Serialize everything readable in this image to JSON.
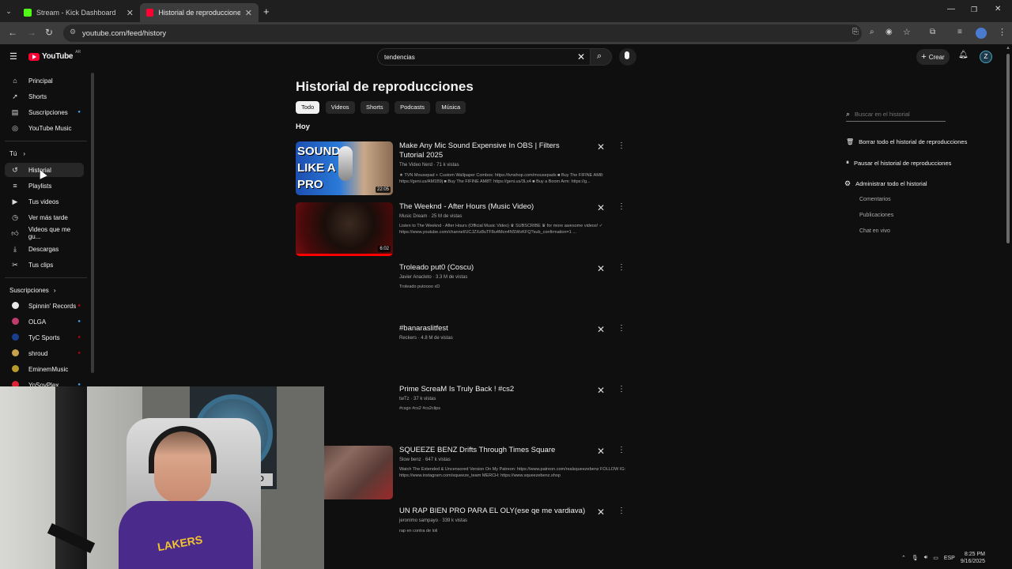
{
  "browser": {
    "tabs": [
      {
        "title": "Stream - Kick Dashboard",
        "favicon_color": "#53fc18"
      },
      {
        "title": "Historial de reproducciones - Y",
        "favicon_color": "#ff0033"
      }
    ],
    "url": "youtube.com/feed/history"
  },
  "header": {
    "logo": "YouTube",
    "region": "AR",
    "search_value": "tendencias",
    "create_label": "Crear",
    "avatar_letter": "Z"
  },
  "sidebar": {
    "main_items": [
      {
        "label": "Principal",
        "icon": "home-icon"
      },
      {
        "label": "Shorts",
        "icon": "shorts-icon"
      },
      {
        "label": "Suscripciones",
        "icon": "subscriptions-icon"
      },
      {
        "label": "YouTube Music",
        "icon": "music-icon"
      }
    ],
    "you_label": "Tú",
    "you_items": [
      {
        "label": "Historial",
        "icon": "history-icon"
      },
      {
        "label": "Playlists",
        "icon": "playlist-icon"
      },
      {
        "label": "Tus videos",
        "icon": "video-icon"
      },
      {
        "label": "Ver más tarde",
        "icon": "clock-icon"
      },
      {
        "label": "Videos que me gu...",
        "icon": "like-icon"
      },
      {
        "label": "Descargas",
        "icon": "download-icon"
      },
      {
        "label": "Tus clips",
        "icon": "scissors-icon"
      }
    ],
    "subscriptions_label": "Suscripciones",
    "subscriptions": [
      {
        "label": "Spinnin' Records",
        "color": "#e8e8e8"
      },
      {
        "label": "OLGA",
        "color": "#c03a6b"
      },
      {
        "label": "TyC Sports",
        "color": "#1a3f8f"
      },
      {
        "label": "shroud",
        "color": "#c7a24a"
      },
      {
        "label": "EminemMusic",
        "color": "#b89b2a"
      },
      {
        "label": "YoSoyPlex",
        "color": "#d23"
      }
    ]
  },
  "main": {
    "page_title": "Historial de reproducciones",
    "chips": [
      "Todo",
      "Videos",
      "Shorts",
      "Podcasts",
      "Música"
    ],
    "section_label": "Hoy",
    "videos": [
      {
        "title": "Make Any Mic Sound Expensive In OBS | Filters Tutorial 2025",
        "meta": "The Video Nerd · 71 k vistas",
        "desc": "★ TVN Mousepad + Custom Wallpaper Combos: https://tvnshop.com/mousepads ■ Buy The FIFINE AM8: https://geni.us/AM1B9j ■ Buy The FIFINE AM8T: https://geni.us/3Lx4 ■ Buy a Boom Arm: https://g...",
        "duration": "22:05",
        "thumb_text": "SOUND LIKE A PRO"
      },
      {
        "title": "The Weeknd - After Hours (Music Video)",
        "meta": "Music Dream · 25 M de vistas",
        "desc": "Listen to The Weeknd - After Hours (Official Music Video) ♛ SUBSCRIBE ♛ for more awesome videos! ✓ https://www.youtube.com/channel/UCJZXz8uTF8u4Mon4NSWvKFQ?sub_confirmation=1 ...",
        "duration": "6:02"
      },
      {
        "title": "Troleado put0 (Coscu)",
        "meta": "Javier Anacleto · 3.3 M de vistas",
        "desc": "Troleado putoooo xD"
      },
      {
        "title": "#banaraslitfest",
        "meta": "Reckers · 4.8 M de vistas",
        "desc": ""
      },
      {
        "title": "Prime ScreaM Is Truly Back ! #cs2",
        "meta": "twTz · 37 k vistas",
        "desc": "#csgo #cs2 #cs2clips"
      },
      {
        "title": "SQUEEZE BENZ Drifts Through Times Square",
        "meta": "Slow benz · 647 k vistas",
        "desc": "Watch The Extended & Uncensored Version On My Patreon: https://www.patreon.com/realsqueezebenz FOLLOW IG: https://www.instagram.com/squeeze_team MERCH: https://www.squeezebenz.shop"
      },
      {
        "title": "UN RAP BIEN PRO PARA EL OLY(ese qe me vardiava)",
        "meta": "jeronimo sampayo · 339 k vistas",
        "desc": "rap en contra de loli"
      }
    ]
  },
  "right_panel": {
    "search_placeholder": "Buscar en el historial",
    "clear_all": "Borrar todo el historial de reproducciones",
    "pause": "Pausar el historial de reproducciones",
    "manage": "Administrar todo el historial",
    "sub_items": [
      "Comentarios",
      "Publicaciones",
      "Chat en vivo"
    ]
  },
  "taskbar": {
    "lang": "ESP",
    "time": "8:25 PM",
    "date": "9/16/2025"
  }
}
